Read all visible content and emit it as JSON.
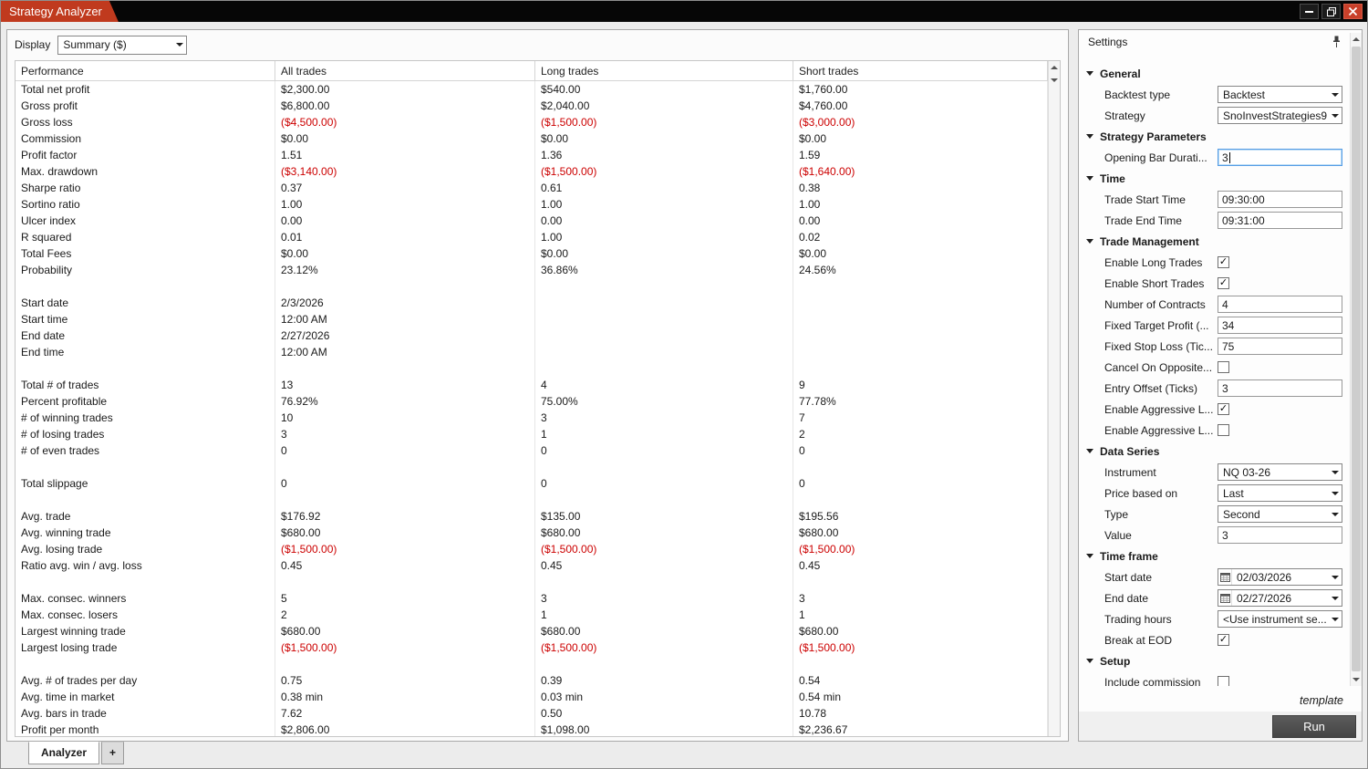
{
  "window": {
    "title": "Strategy Analyzer"
  },
  "toolbar": {
    "display_label": "Display",
    "display_value": "Summary ($)"
  },
  "table": {
    "columns": [
      "Performance",
      "All trades",
      "Long trades",
      "Short trades"
    ],
    "rows": [
      {
        "label": "Total net profit",
        "values": [
          "$2,300.00",
          "$540.00",
          "$1,760.00"
        ]
      },
      {
        "label": "Gross profit",
        "values": [
          "$6,800.00",
          "$2,040.00",
          "$4,760.00"
        ]
      },
      {
        "label": "Gross loss",
        "values": [
          "($4,500.00)",
          "($1,500.00)",
          "($3,000.00)"
        ]
      },
      {
        "label": "Commission",
        "values": [
          "$0.00",
          "$0.00",
          "$0.00"
        ]
      },
      {
        "label": "Profit factor",
        "values": [
          "1.51",
          "1.36",
          "1.59"
        ]
      },
      {
        "label": "Max. drawdown",
        "values": [
          "($3,140.00)",
          "($1,500.00)",
          "($1,640.00)"
        ]
      },
      {
        "label": "Sharpe ratio",
        "values": [
          "0.37",
          "0.61",
          "0.38"
        ]
      },
      {
        "label": "Sortino ratio",
        "values": [
          "1.00",
          "1.00",
          "1.00"
        ]
      },
      {
        "label": "Ulcer index",
        "values": [
          "0.00",
          "0.00",
          "0.00"
        ]
      },
      {
        "label": "R squared",
        "values": [
          "0.01",
          "1.00",
          "0.02"
        ]
      },
      {
        "label": "Total Fees",
        "values": [
          "$0.00",
          "$0.00",
          "$0.00"
        ]
      },
      {
        "label": "Probability",
        "values": [
          "23.12%",
          "36.86%",
          "24.56%"
        ]
      },
      {
        "label": "",
        "values": [
          "",
          "",
          ""
        ]
      },
      {
        "label": "Start date",
        "values": [
          "2/3/2026",
          "",
          ""
        ]
      },
      {
        "label": "Start time",
        "values": [
          "12:00 AM",
          "",
          ""
        ]
      },
      {
        "label": "End date",
        "values": [
          "2/27/2026",
          "",
          ""
        ]
      },
      {
        "label": "End time",
        "values": [
          "12:00 AM",
          "",
          ""
        ]
      },
      {
        "label": "",
        "values": [
          "",
          "",
          ""
        ]
      },
      {
        "label": "Total # of trades",
        "values": [
          "13",
          "4",
          "9"
        ]
      },
      {
        "label": "Percent profitable",
        "values": [
          "76.92%",
          "75.00%",
          "77.78%"
        ]
      },
      {
        "label": "# of winning trades",
        "values": [
          "10",
          "3",
          "7"
        ]
      },
      {
        "label": "# of losing trades",
        "values": [
          "3",
          "1",
          "2"
        ]
      },
      {
        "label": "# of even trades",
        "values": [
          "0",
          "0",
          "0"
        ]
      },
      {
        "label": "",
        "values": [
          "",
          "",
          ""
        ]
      },
      {
        "label": "Total slippage",
        "values": [
          "0",
          "0",
          "0"
        ]
      },
      {
        "label": "",
        "values": [
          "",
          "",
          ""
        ]
      },
      {
        "label": "Avg. trade",
        "values": [
          "$176.92",
          "$135.00",
          "$195.56"
        ]
      },
      {
        "label": "Avg. winning trade",
        "values": [
          "$680.00",
          "$680.00",
          "$680.00"
        ]
      },
      {
        "label": "Avg. losing trade",
        "values": [
          "($1,500.00)",
          "($1,500.00)",
          "($1,500.00)"
        ]
      },
      {
        "label": "Ratio avg. win / avg. loss",
        "values": [
          "0.45",
          "0.45",
          "0.45"
        ]
      },
      {
        "label": "",
        "values": [
          "",
          "",
          ""
        ]
      },
      {
        "label": "Max. consec. winners",
        "values": [
          "5",
          "3",
          "3"
        ]
      },
      {
        "label": "Max. consec. losers",
        "values": [
          "2",
          "1",
          "1"
        ]
      },
      {
        "label": "Largest winning trade",
        "values": [
          "$680.00",
          "$680.00",
          "$680.00"
        ]
      },
      {
        "label": "Largest losing trade",
        "values": [
          "($1,500.00)",
          "($1,500.00)",
          "($1,500.00)"
        ]
      },
      {
        "label": "",
        "values": [
          "",
          "",
          ""
        ]
      },
      {
        "label": "Avg. # of trades per day",
        "values": [
          "0.75",
          "0.39",
          "0.54"
        ]
      },
      {
        "label": "Avg. time in market",
        "values": [
          "0.38 min",
          "0.03 min",
          "0.54 min"
        ]
      },
      {
        "label": "Avg. bars in trade",
        "values": [
          "7.62",
          "0.50",
          "10.78"
        ]
      },
      {
        "label": "Profit per month",
        "values": [
          "$2,806.00",
          "$1,098.00",
          "$2,236.67"
        ]
      }
    ]
  },
  "tabs": {
    "analyzer": "Analyzer",
    "add": "+"
  },
  "settings": {
    "title": "Settings",
    "sections": [
      {
        "label": "General",
        "items": [
          {
            "label": "Backtest type",
            "type": "select",
            "value": "Backtest"
          },
          {
            "label": "Strategy",
            "type": "select",
            "value": "SnoInvestStrategies9:"
          }
        ]
      },
      {
        "label": "Strategy Parameters",
        "items": [
          {
            "label": "Opening Bar Durati...",
            "type": "input",
            "value": "3",
            "focused": true
          }
        ]
      },
      {
        "label": "Time",
        "items": [
          {
            "label": "Trade Start Time",
            "type": "input",
            "value": "09:30:00"
          },
          {
            "label": "Trade End Time",
            "type": "input",
            "value": "09:31:00"
          }
        ]
      },
      {
        "label": "Trade Management",
        "items": [
          {
            "label": "Enable Long Trades",
            "type": "checkbox",
            "checked": true
          },
          {
            "label": "Enable Short Trades",
            "type": "checkbox",
            "checked": true
          },
          {
            "label": "Number of Contracts",
            "type": "input",
            "value": "4"
          },
          {
            "label": "Fixed Target Profit (...",
            "type": "input",
            "value": "34"
          },
          {
            "label": "Fixed Stop Loss (Tic...",
            "type": "input",
            "value": "75"
          },
          {
            "label": "Cancel On Opposite...",
            "type": "checkbox",
            "checked": false
          },
          {
            "label": "Entry Offset (Ticks)",
            "type": "input",
            "value": "3"
          },
          {
            "label": "Enable Aggressive L...",
            "type": "checkbox",
            "checked": true
          },
          {
            "label": "Enable Aggressive L...",
            "type": "checkbox",
            "checked": false
          }
        ]
      },
      {
        "label": "Data Series",
        "items": [
          {
            "label": "Instrument",
            "type": "select",
            "value": "NQ 03-26"
          },
          {
            "label": "Price based on",
            "type": "select",
            "value": "Last"
          },
          {
            "label": "Type",
            "type": "select",
            "value": "Second"
          },
          {
            "label": "Value",
            "type": "input",
            "value": "3"
          }
        ]
      },
      {
        "label": "Time frame",
        "items": [
          {
            "label": "Start date",
            "type": "date",
            "value": "02/03/2026"
          },
          {
            "label": "End date",
            "type": "date",
            "value": "02/27/2026"
          },
          {
            "label": "Trading hours",
            "type": "select",
            "value": "<Use instrument se..."
          },
          {
            "label": "Break at EOD",
            "type": "checkbox",
            "checked": true
          }
        ]
      },
      {
        "label": "Setup",
        "items": [
          {
            "label": "Include commission",
            "type": "checkbox",
            "checked": false
          }
        ]
      }
    ],
    "template_label": "template",
    "run_label": "Run"
  },
  "colors": {
    "title_tab": "#c03a1e",
    "close_button": "#c9402a",
    "negative_value": "#cc0000",
    "focus_border": "#569de5",
    "run_button": "#5c5c5c"
  }
}
